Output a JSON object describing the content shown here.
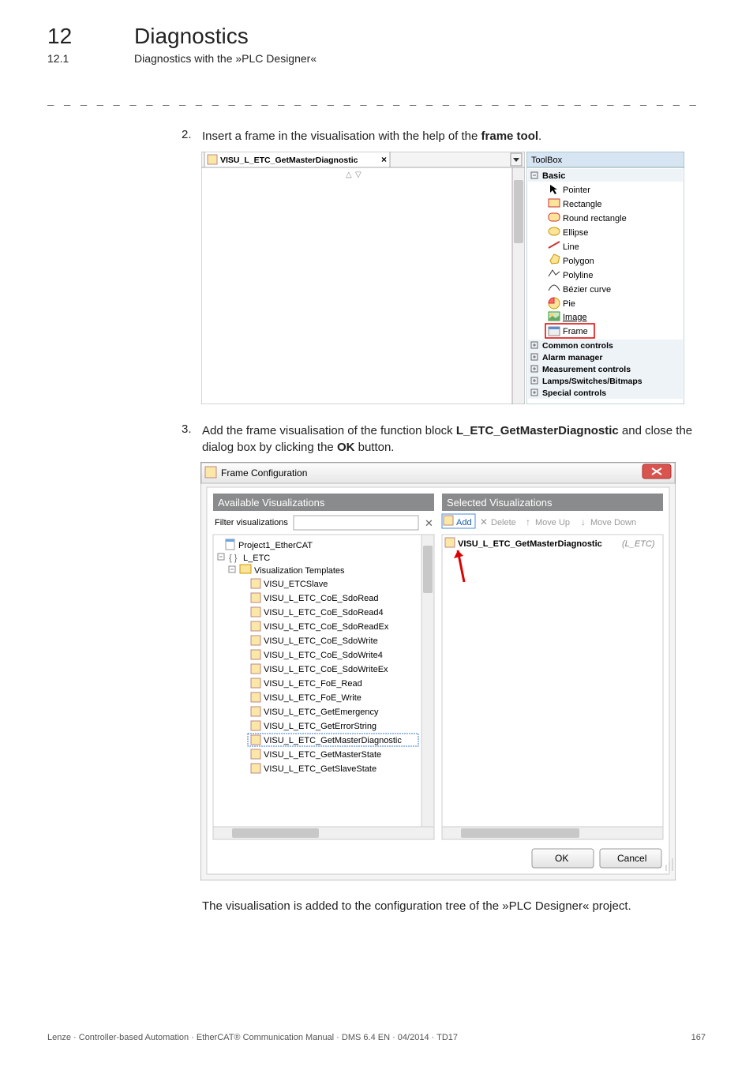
{
  "header": {
    "chapter_num": "12",
    "chapter_title": "Diagnostics",
    "section_num": "12.1",
    "section_title": "Diagnostics with the »PLC Designer«"
  },
  "steps": {
    "s2_num": "2.",
    "s2_text_a": "Insert a frame in the visualisation with the help of the ",
    "s2_text_b": "frame tool",
    "s2_text_c": ".",
    "s3_num": "3.",
    "s3_text_a": "Add the frame visualisation of the function block ",
    "s3_text_b": "L_ETC_GetMasterDiagnostic",
    "s3_text_c": " and close the dialog box by clicking the ",
    "s3_text_d": "OK",
    "s3_text_e": " button.",
    "after": "The visualisation is added to the configuration tree of the »PLC Designer« project."
  },
  "fig1": {
    "tab": "VISU_L_ETC_GetMasterDiagnostic",
    "tab_close": "×",
    "toolbox_title": "ToolBox",
    "basic_hdr": "Basic",
    "items": {
      "pointer": "Pointer",
      "rectangle": "Rectangle",
      "round_rect": "Round rectangle",
      "ellipse": "Ellipse",
      "line": "Line",
      "polygon": "Polygon",
      "polyline": "Polyline",
      "bezier": "Bézier curve",
      "pie": "Pie",
      "image": "Image",
      "frame": "Frame"
    },
    "groups": {
      "common": "Common controls",
      "alarm": "Alarm manager",
      "measure": "Measurement controls",
      "lamps": "Lamps/Switches/Bitmaps",
      "special": "Special controls"
    }
  },
  "fig2": {
    "title": "Frame Configuration",
    "avail_hdr": "Available Visualizations",
    "sel_hdr": "Selected Visualizations",
    "filter_label": "Filter visualizations",
    "filter_clear": "✕",
    "toolbar": {
      "add": "Add",
      "delete": "Delete",
      "moveup": "Move Up",
      "movedown": "Move Down"
    },
    "tree": {
      "root": "Project1_EtherCAT",
      "lib": "L_ETC",
      "folder": "Visualization Templates",
      "items": [
        "VISU_ETCSlave",
        "VISU_L_ETC_CoE_SdoRead",
        "VISU_L_ETC_CoE_SdoRead4",
        "VISU_L_ETC_CoE_SdoReadEx",
        "VISU_L_ETC_CoE_SdoWrite",
        "VISU_L_ETC_CoE_SdoWrite4",
        "VISU_L_ETC_CoE_SdoWriteEx",
        "VISU_L_ETC_FoE_Read",
        "VISU_L_ETC_FoE_Write",
        "VISU_L_ETC_GetEmergency",
        "VISU_L_ETC_GetErrorString",
        "VISU_L_ETC_GetMasterDiagnostic",
        "VISU_L_ETC_GetMasterState",
        "VISU_L_ETC_GetSlaveState"
      ]
    },
    "selected_item": "VISU_L_ETC_GetMasterDiagnostic",
    "selected_lib": "(L_ETC)",
    "ok": "OK",
    "cancel": "Cancel"
  },
  "footer": {
    "left": "Lenze · Controller-based Automation · EtherCAT® Communication Manual · DMS 6.4 EN · 04/2014 · TD17",
    "right": "167"
  },
  "dashes": "_ _ _ _ _ _ _ _ _ _ _ _ _ _ _ _ _ _ _ _ _ _ _ _ _ _ _ _ _ _ _ _ _ _ _ _ _ _ _ _ _ _ _ _ _ _ _ _ _ _ _ _ _ _ _ _ _ _ _ _ _ _ _ _"
}
